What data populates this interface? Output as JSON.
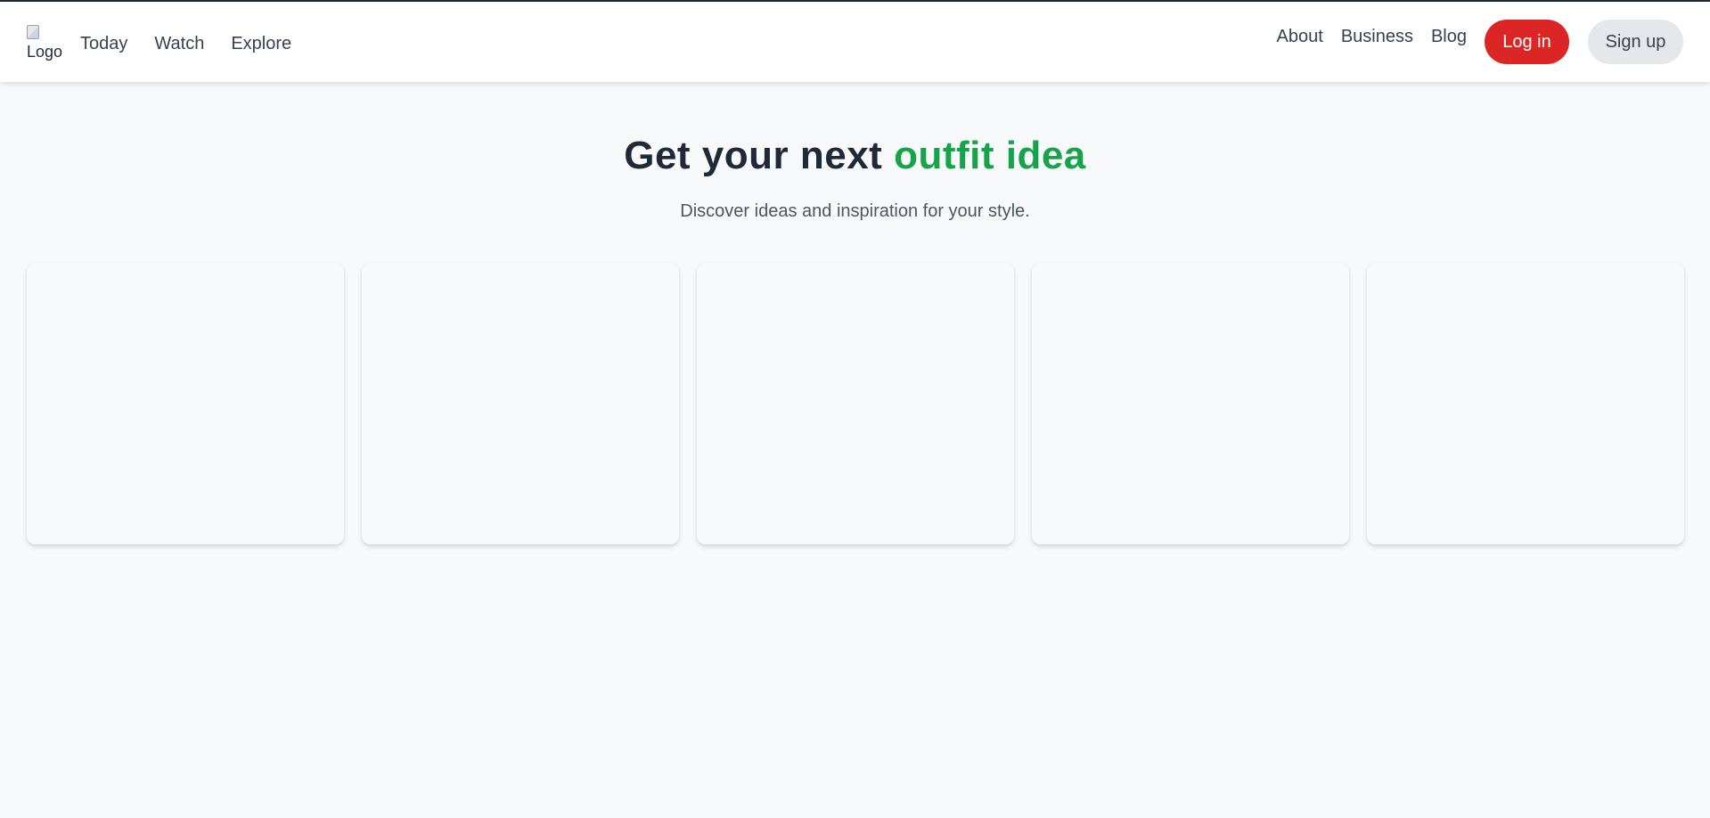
{
  "header": {
    "logo_alt": "Logo",
    "nav_left": [
      {
        "label": "Today"
      },
      {
        "label": "Watch"
      },
      {
        "label": "Explore"
      }
    ],
    "nav_right": [
      {
        "label": "About"
      },
      {
        "label": "Business"
      },
      {
        "label": "Blog"
      }
    ],
    "login_label": "Log in",
    "signup_label": "Sign up"
  },
  "hero": {
    "title_prefix": "Get your next",
    "title_accent": "outfit idea",
    "subtitle": "Discover ideas and inspiration for your style."
  },
  "cards": [
    {
      "id": "card-1"
    },
    {
      "id": "card-2"
    },
    {
      "id": "card-3"
    },
    {
      "id": "card-4"
    },
    {
      "id": "card-5"
    }
  ],
  "colors": {
    "accent_green": "#16a34a",
    "login_red": "#dc2626",
    "signup_gray": "#e5e7eb",
    "page_background": "#f8f9fb"
  }
}
